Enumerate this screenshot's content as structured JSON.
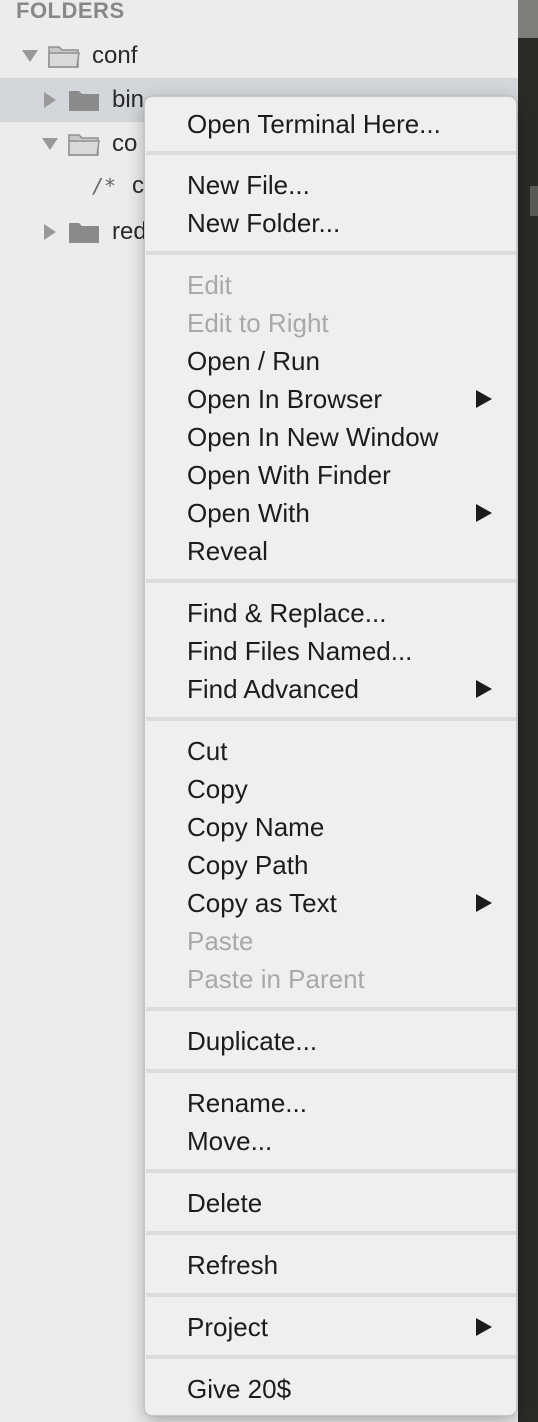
{
  "sidebar": {
    "header": "FOLDERS",
    "rows": [
      {
        "label": "conf",
        "expanded": true,
        "icon": "open-folder-icon"
      },
      {
        "label": "bin",
        "expanded": false,
        "icon": "folder-icon",
        "selected": true
      },
      {
        "label": "co",
        "expanded": true,
        "icon": "open-folder-icon"
      },
      {
        "prefix": "/*",
        "label": "c",
        "icon": "comment-file-icon"
      },
      {
        "label": "red",
        "expanded": false,
        "icon": "folder-icon"
      }
    ]
  },
  "menu": {
    "items": {
      "open_terminal": {
        "label": "Open Terminal Here..."
      },
      "new_file": {
        "label": "New File..."
      },
      "new_folder": {
        "label": "New Folder..."
      },
      "edit": {
        "label": "Edit",
        "disabled": true
      },
      "edit_to_right": {
        "label": "Edit to Right",
        "disabled": true
      },
      "open_run": {
        "label": "Open / Run"
      },
      "open_in_browser": {
        "label": "Open In Browser",
        "submenu": true
      },
      "open_in_new_window": {
        "label": "Open In New Window"
      },
      "open_with_finder": {
        "label": "Open With Finder"
      },
      "open_with": {
        "label": "Open With",
        "submenu": true
      },
      "reveal": {
        "label": "Reveal"
      },
      "find_replace": {
        "label": "Find & Replace..."
      },
      "find_files_named": {
        "label": "Find Files Named..."
      },
      "find_advanced": {
        "label": "Find Advanced",
        "submenu": true
      },
      "cut": {
        "label": "Cut"
      },
      "copy": {
        "label": "Copy"
      },
      "copy_name": {
        "label": "Copy Name"
      },
      "copy_path": {
        "label": "Copy Path"
      },
      "copy_as_text": {
        "label": "Copy as Text",
        "submenu": true
      },
      "paste": {
        "label": "Paste",
        "disabled": true
      },
      "paste_in_parent": {
        "label": "Paste in Parent",
        "disabled": true
      },
      "duplicate": {
        "label": "Duplicate..."
      },
      "rename": {
        "label": "Rename..."
      },
      "move": {
        "label": "Move..."
      },
      "delete": {
        "label": "Delete"
      },
      "refresh": {
        "label": "Refresh"
      },
      "project": {
        "label": "Project",
        "submenu": true
      },
      "give": {
        "label": "Give 20$"
      }
    }
  },
  "colors": {
    "sidebar_bg": "#ececec",
    "selected_row": "#d3d6db",
    "menu_bg": "#efefef",
    "disabled_text": "#a9a9a9",
    "editor_bg": "#2a2a26"
  }
}
